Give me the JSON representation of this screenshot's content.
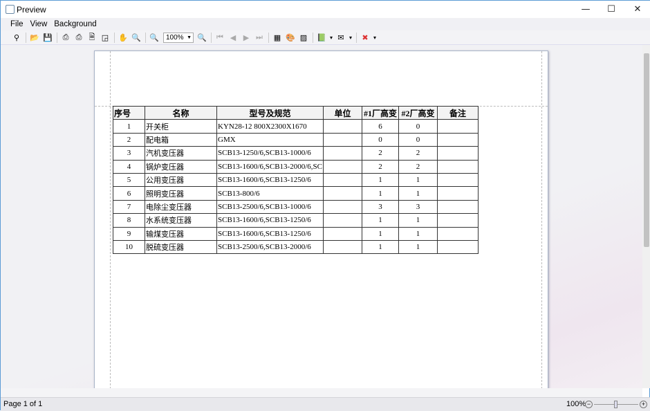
{
  "window": {
    "title": "Preview",
    "minimize": "—",
    "maximize": "☐",
    "close": "✕"
  },
  "menu": [
    "File",
    "View",
    "Background"
  ],
  "toolbar": {
    "zoom_value": "100%",
    "buttons": [
      {
        "icon": "binoculars-icon",
        "glyph": "⚲"
      },
      {
        "sep": true
      },
      {
        "icon": "open-folder-icon",
        "glyph": "📂"
      },
      {
        "icon": "save-icon",
        "glyph": "💾"
      },
      {
        "sep": true
      },
      {
        "icon": "print-setup-icon",
        "glyph": "⎙"
      },
      {
        "icon": "print-icon",
        "glyph": "⎙"
      },
      {
        "icon": "page-setup-icon",
        "glyph": "🗎"
      },
      {
        "icon": "scale-icon",
        "glyph": "◲"
      },
      {
        "sep": true
      },
      {
        "icon": "hand-icon",
        "glyph": "✋"
      },
      {
        "icon": "magnifier-icon",
        "glyph": "🔍"
      },
      {
        "sep": true
      },
      {
        "icon": "zoom-out-icon",
        "glyph": "🔍"
      },
      {
        "zoom": true
      },
      {
        "icon": "zoom-in-icon",
        "glyph": "🔍"
      },
      {
        "sep": true
      },
      {
        "icon": "first-page-icon",
        "glyph": "⏮"
      },
      {
        "icon": "previous-page-icon",
        "glyph": "◀"
      },
      {
        "icon": "next-page-icon",
        "glyph": "▶"
      },
      {
        "icon": "last-page-icon",
        "glyph": "⏭"
      },
      {
        "sep": true
      },
      {
        "icon": "multiple-pages-icon",
        "glyph": "▦"
      },
      {
        "icon": "page-color-icon",
        "glyph": "🎨"
      },
      {
        "icon": "watermark-icon",
        "glyph": "▨"
      },
      {
        "sep": true
      },
      {
        "icon": "export-icon",
        "glyph": "📗"
      },
      {
        "icon": "export-dropdown-icon",
        "glyph": "▾"
      },
      {
        "icon": "email-icon",
        "glyph": "✉"
      },
      {
        "icon": "email-dropdown-icon",
        "glyph": "▾"
      },
      {
        "sep": true
      },
      {
        "icon": "close-preview-icon",
        "glyph": "✖"
      },
      {
        "icon": "overflow-icon",
        "glyph": "▾"
      }
    ]
  },
  "table": {
    "headers": [
      "序号",
      "名称",
      "型号及规范",
      "单位",
      "#1厂高变",
      "#2厂高变",
      "备注"
    ],
    "rows": [
      [
        "1",
        "开关柜",
        "KYN28-12 800X2300X1670",
        "",
        "6",
        "0",
        ""
      ],
      [
        "2",
        "配电箱",
        "GMX",
        "",
        "0",
        "0",
        ""
      ],
      [
        "3",
        "汽机变压器",
        "SCB13-1250/6,SCB13-1000/6",
        "",
        "2",
        "2",
        ""
      ],
      [
        "4",
        "锅炉变压器",
        "SCB13-1600/6,SCB13-2000/6,SC",
        "",
        "2",
        "2",
        ""
      ],
      [
        "5",
        "公用变压器",
        "SCB13-1600/6,SCB13-1250/6",
        "",
        "1",
        "1",
        ""
      ],
      [
        "6",
        "照明变压器",
        "SCB13-800/6",
        "",
        "1",
        "1",
        ""
      ],
      [
        "7",
        "电除尘变压器",
        "SCB13-2500/6,SCB13-1000/6",
        "",
        "3",
        "3",
        ""
      ],
      [
        "8",
        "水系统变压器",
        "SCB13-1600/6,SCB13-1250/6",
        "",
        "1",
        "1",
        ""
      ],
      [
        "9",
        "输煤变压器",
        "SCB13-1600/6,SCB13-1250/6",
        "",
        "1",
        "1",
        ""
      ],
      [
        "10",
        "脱硫变压器",
        "SCB13-2500/6,SCB13-2000/6",
        "",
        "1",
        "1",
        ""
      ]
    ]
  },
  "status": {
    "page": "Page 1 of 1",
    "zoom": "100%",
    "zoom_fraction": 0.5
  }
}
